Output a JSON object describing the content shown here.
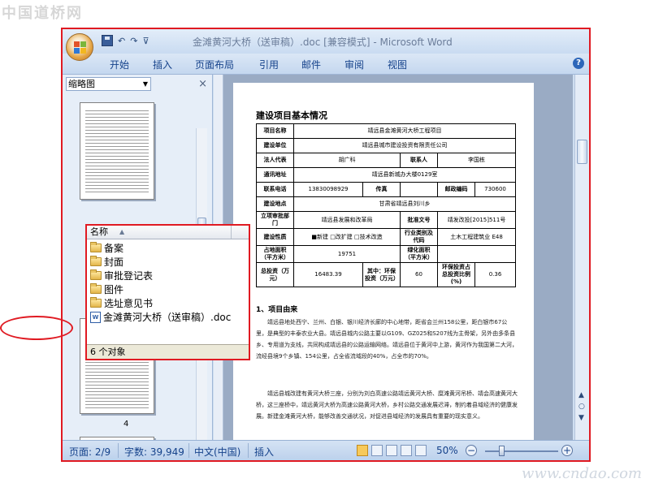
{
  "watermark_top": "中国道桥网",
  "watermark_bottom": "www.cndao.com",
  "window": {
    "title": "金滩黄河大桥（送审稿）.doc [兼容模式] - Microsoft Word",
    "qat_undo": "↶",
    "qat_redo": "↷",
    "qat_more": "⊽"
  },
  "ribbon": {
    "tabs": [
      "开始",
      "插入",
      "页面布局",
      "引用",
      "邮件",
      "审阅",
      "视图"
    ],
    "help": "?"
  },
  "nav_pane": {
    "view": "缩略图",
    "close": "×",
    "thumb_page_number": "4"
  },
  "document": {
    "heading": "建设项目基本情况",
    "table": [
      [
        "项目名称",
        "靖远县金滩黄河大桥工程项目"
      ],
      [
        "建设单位",
        "靖远县城市建设投资有限责任公司"
      ],
      [
        "法人代表",
        "胡广科",
        "联系人",
        "李国栋"
      ],
      [
        "通讯地址",
        "靖远县新城办大楼0129室"
      ],
      [
        "联系电话",
        "13830098929",
        "传真",
        "",
        "邮政编码",
        "730600"
      ],
      [
        "建设地点",
        "甘肃省靖远县刘川乡"
      ],
      [
        "立项审批部门",
        "靖远县发展和改革局",
        "批准文号",
        "靖发改投[2015]511号"
      ],
      [
        "建设性质",
        "■新建 □改扩建 □技术改造",
        "行业类别及代码",
        "土木工程建筑业 E48"
      ],
      [
        "占地面积（平方米）",
        "19751",
        "绿化面积（平方米）",
        ""
      ],
      [
        "总投资（万元）",
        "16483.39",
        "其中：环保投资（万元）",
        "60",
        "环保投资占总投资比例(%)",
        "0.36"
      ]
    ],
    "section1": "1、项目由来",
    "para1": "靖远县地处西宁、兰州、白银、银川经济长廊的中心地带，距省会兰州158公里，距白银市67公里，是典型的丰泰农业大县。靖远县城内公路主要以G109、GZ025和S207线为主骨架，另外由多条县乡、专用道为支线，共同构成靖远县的公路运输网络。靖远县位于黄河中上游，黄河作为我国第二大河，流经县境9个乡镇、154公里，占全省流域段的40%，占全市的70%。",
    "para2": "靖远县城改建有黄河大桥三座，分别为刘白高速公路靖远黄河大桥、糜滩黄河吊桥、靖会高速黄河大桥，这三座桥中，靖远黄河大桥为高速公路黄河大桥，乡村公路交通发展迟滞，制约着县域经济的健康发展。新建金滩黄河大桥，能够改善交通状况，对促进县域经济的发展具有重要的现实意义。"
  },
  "explorer": {
    "column": "名称",
    "items": [
      "备案",
      "封面",
      "审批登记表",
      "图件",
      "选址意见书"
    ],
    "file": "金滩黄河大桥（送审稿）.doc",
    "status": "6 个对象"
  },
  "status": {
    "page": "页面: 2/9",
    "words": "字数: 39,949",
    "lang": "中文(中国)",
    "mode": "插入",
    "zoom": "50%",
    "zoom_level": 0.5
  }
}
